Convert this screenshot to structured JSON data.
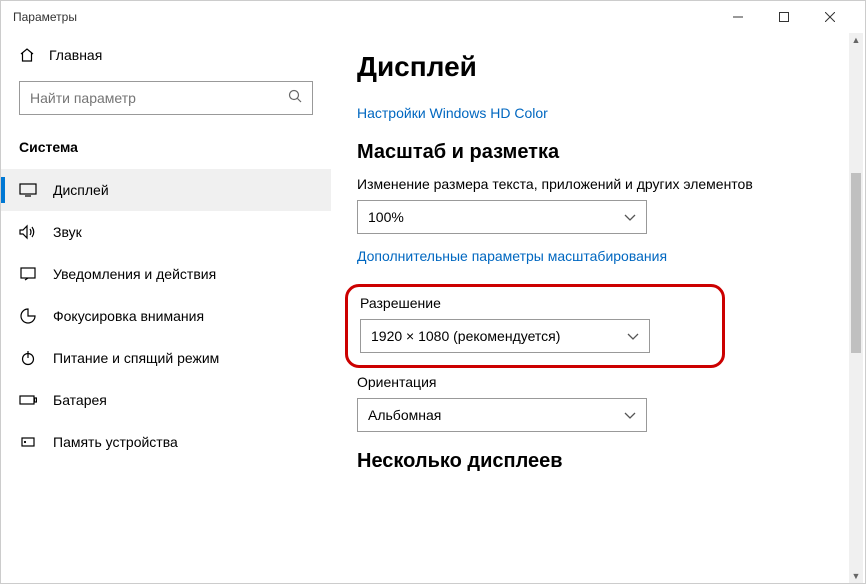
{
  "window": {
    "title": "Параметры"
  },
  "sidebar": {
    "home": "Главная",
    "search_placeholder": "Найти параметр",
    "section": "Система",
    "items": [
      {
        "label": "Дисплей"
      },
      {
        "label": "Звук"
      },
      {
        "label": "Уведомления и действия"
      },
      {
        "label": "Фокусировка внимания"
      },
      {
        "label": "Питание и спящий режим"
      },
      {
        "label": "Батарея"
      },
      {
        "label": "Память устройства"
      }
    ]
  },
  "main": {
    "title": "Дисплей",
    "hd_color_link": "Настройки Windows HD Color",
    "scale_heading": "Масштаб и разметка",
    "scale_label": "Изменение размера текста, приложений и других элементов",
    "scale_value": "100%",
    "advanced_scale_link": "Дополнительные параметры масштабирования",
    "resolution_label": "Разрешение",
    "resolution_value": "1920 × 1080 (рекомендуется)",
    "orientation_label": "Ориентация",
    "orientation_value": "Альбомная",
    "multi_heading": "Несколько дисплеев"
  }
}
